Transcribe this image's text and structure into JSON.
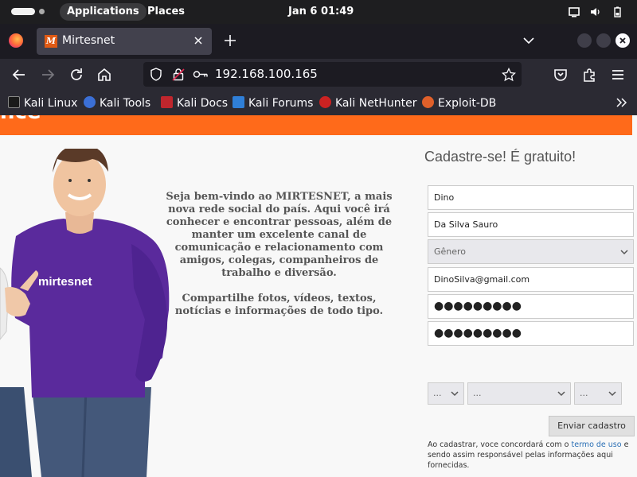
{
  "topbar": {
    "applications": "Applications",
    "places": "Places",
    "clock": "Jan 6  01:49"
  },
  "browser": {
    "tab_title": "Mirtesnet",
    "tab_favicon_letter": "M",
    "url": "192.168.100.165"
  },
  "bookmarks": [
    {
      "label": "Kali Linux",
      "icon": "kali-dragon-icon",
      "color": "#1a1a1a"
    },
    {
      "label": "Kali Tools",
      "icon": "kali-tools-icon",
      "color": "#3b6fd6"
    },
    {
      "label": "Kali Docs",
      "icon": "kali-docs-icon",
      "color": "#c0262d"
    },
    {
      "label": "Kali Forums",
      "icon": "kali-forums-icon",
      "color": "#2f7fd8"
    },
    {
      "label": "Kali NetHunter",
      "icon": "kali-nethunter-icon",
      "color": "#cc2222"
    },
    {
      "label": "Exploit-DB",
      "icon": "exploit-db-icon",
      "color": "#e0602a"
    }
  ],
  "page": {
    "welcome_paragraph": "Seja bem-vindo ao MIRTESNET, a  mais nova rede social do país. Aqui você irá conhecer e encontrar  pessoas, além de manter um  excelente canal de comunicação e  relacionamento com amigos,  colegas, companheiros de trabalho e  diversão.",
    "share_paragraph": "Compartilhe fotos, vídeos, textos, notícias e informações de todo tipo.",
    "shirt_text": "mirtesnet",
    "accent_color": "#ff6a1a"
  },
  "form": {
    "heading": "Cadastre-se! É gratuito!",
    "first_name": "Dino",
    "last_name": "Da Silva Sauro",
    "gender_placeholder": "Gênero",
    "email": "DinoSilva@gmail.com",
    "password": "●●●●●●●●●",
    "password_confirm": "●●●●●●●●●",
    "birth_day": "...",
    "birth_month": "...",
    "birth_year": "...",
    "submit_label": "Enviar cadastro",
    "terms_before": "Ao cadastrar, voce concordará com o ",
    "terms_link": "termo de uso",
    "terms_after": " e sendo assim responsável pelas informações aqui fornecidas."
  }
}
